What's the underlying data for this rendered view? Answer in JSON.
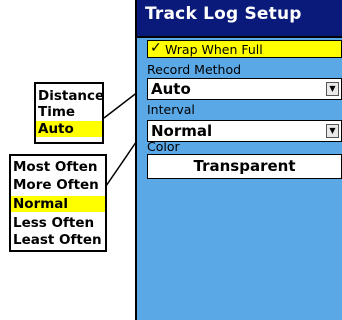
{
  "window": {
    "title": "Track Log Setup"
  },
  "wrap": {
    "checked": true,
    "label": "Wrap When Full"
  },
  "record_method": {
    "label": "Record Method",
    "value": "Auto",
    "options": [
      "Distance",
      "Time",
      "Auto"
    ],
    "selected_index": 2
  },
  "interval": {
    "label": "Interval",
    "value": "Normal",
    "options": [
      "Most Often",
      "More Often",
      "Normal",
      "Less Often",
      "Least Often"
    ],
    "selected_index": 2
  },
  "color": {
    "label": "Color",
    "value": "Transparent"
  },
  "icons": {
    "check": "checkmark-icon",
    "dropdown_arrow": "triangle-down-icon"
  },
  "colors": {
    "screen_bg": "#5aa8e6",
    "title_bg": "#0a1a7a",
    "highlight": "#ffff00"
  }
}
